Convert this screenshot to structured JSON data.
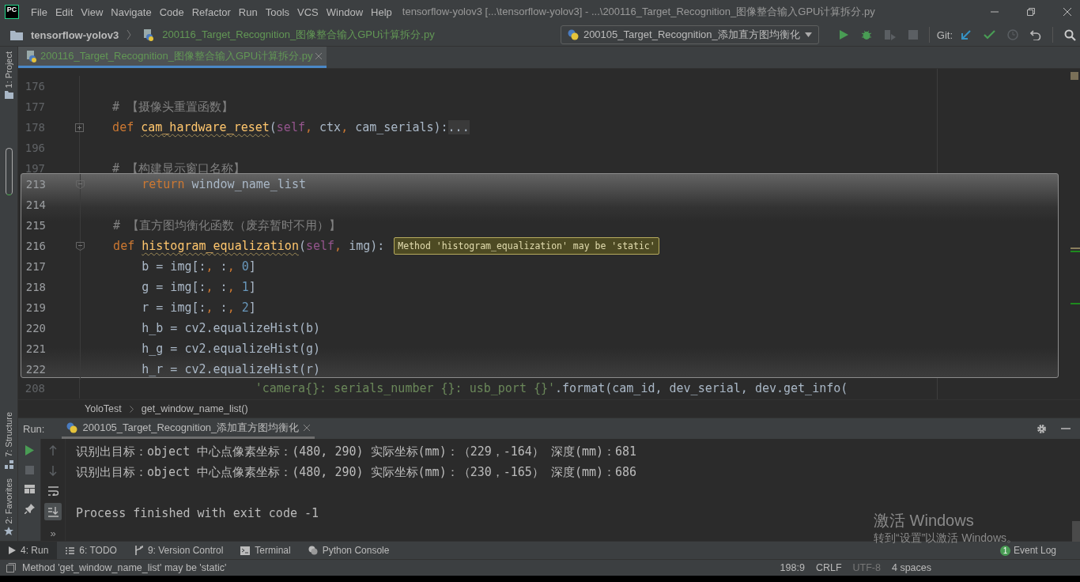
{
  "menu": {
    "logo": "PC",
    "items": [
      "File",
      "Edit",
      "View",
      "Navigate",
      "Code",
      "Refactor",
      "Run",
      "Tools",
      "VCS",
      "Window",
      "Help"
    ]
  },
  "window": {
    "title": "tensorflow-yolov3 [...\\tensorflow-yolov3] - ...\\200116_Target_Recognition_图像整合输入GPU计算拆分.py"
  },
  "navbar": {
    "project": "tensorflow-yolov3",
    "file": "200116_Target_Recognition_图像整合输入GPU计算拆分.py",
    "run_config": "200105_Target_Recognition_添加直方图均衡化",
    "git_label": "Git:"
  },
  "editor_tabs": [
    {
      "label": "200116_Target_Recognition_图像整合输入GPU计算拆分.py",
      "selected": true
    }
  ],
  "side_tools": [
    {
      "label": "1: Project",
      "kind": "project"
    },
    {
      "label": "7: Structure",
      "kind": "structure"
    },
    {
      "label": "2: Favorites",
      "kind": "favorites"
    }
  ],
  "code_lines": [
    {
      "number": "176"
    },
    {
      "number": "177",
      "tokens": [
        {
          "t": "    # 【摄像头重置函数】",
          "kind": "comment"
        }
      ]
    },
    {
      "number": "178",
      "collapsed": true,
      "tokens": [
        {
          "t": "    def ",
          "kind": "kw"
        },
        {
          "t": "cam_hardware_reset",
          "kind": "fn",
          "warning": true
        },
        {
          "t": "(",
          "kind": "plain"
        },
        {
          "t": "self",
          "kind": "self"
        },
        {
          "t": ", ",
          "kind": "kw"
        },
        {
          "t": "ctx",
          "kind": "plain"
        },
        {
          "t": ", ",
          "kind": "kw"
        },
        {
          "t": "cam_serials):",
          "kind": "plain"
        },
        {
          "t": "...",
          "kind": "folded"
        }
      ]
    },
    {
      "number": "196"
    },
    {
      "number": "197",
      "tokens": [
        {
          "t": "    # 【构建显示窗口名称】",
          "kind": "comment"
        }
      ]
    },
    {
      "number": "208",
      "tokens": [
        {
          "t": "                        'camera{}: serials_number {}: usb_port {}'",
          "kind": "str"
        },
        {
          "t": ".format(cam_id, dev_serial, dev.get_info(",
          "kind": "plain"
        }
      ]
    }
  ],
  "peek": {
    "lines": [
      {
        "number": "213",
        "collapsed": false,
        "tokens": [
          {
            "t": "        return ",
            "kind": "kw"
          },
          {
            "t": "window_name_list",
            "kind": "plain"
          }
        ]
      },
      {
        "number": "214"
      },
      {
        "number": "215",
        "tokens": [
          {
            "t": "    # 【直方图均衡化函数（废弃暂时不用）】",
            "kind": "comment"
          }
        ]
      },
      {
        "number": "216",
        "collapsed": false,
        "tokens": [
          {
            "t": "    def ",
            "kind": "kw"
          },
          {
            "t": "histogram_equalization",
            "kind": "fn",
            "warning": true
          },
          {
            "t": "(",
            "kind": "plain"
          },
          {
            "t": "self",
            "kind": "self"
          },
          {
            "t": ", ",
            "kind": "kw"
          },
          {
            "t": "img):",
            "kind": "plain"
          }
        ],
        "tooltip": "Method 'histogram_equalization' may be 'static'"
      },
      {
        "number": "217",
        "tokens": [
          {
            "t": "        b = img[:",
            "kind": "plain"
          },
          {
            "t": ", ",
            "kind": "kw"
          },
          {
            "t": ":",
            "kind": "plain"
          },
          {
            "t": ", ",
            "kind": "kw"
          },
          {
            "t": "0",
            "kind": "num"
          },
          {
            "t": "]",
            "kind": "plain"
          }
        ]
      },
      {
        "number": "218",
        "tokens": [
          {
            "t": "        g = img[:",
            "kind": "plain"
          },
          {
            "t": ", ",
            "kind": "kw"
          },
          {
            "t": ":",
            "kind": "plain"
          },
          {
            "t": ", ",
            "kind": "kw"
          },
          {
            "t": "1",
            "kind": "num"
          },
          {
            "t": "]",
            "kind": "plain"
          }
        ]
      },
      {
        "number": "219",
        "tokens": [
          {
            "t": "        r = img[:",
            "kind": "plain"
          },
          {
            "t": ", ",
            "kind": "kw"
          },
          {
            "t": ":",
            "kind": "plain"
          },
          {
            "t": ", ",
            "kind": "kw"
          },
          {
            "t": "2",
            "kind": "num"
          },
          {
            "t": "]",
            "kind": "plain"
          }
        ]
      },
      {
        "number": "220",
        "tokens": [
          {
            "t": "        h_b = cv2.equalizeHist(b)",
            "kind": "plain"
          }
        ]
      },
      {
        "number": "221",
        "tokens": [
          {
            "t": "        h_g = cv2.equalizeHist(g)",
            "kind": "plain"
          }
        ]
      },
      {
        "number": "222",
        "tokens": [
          {
            "t": "        h_r = cv2.equalizeHist(r)",
            "kind": "plain"
          }
        ]
      }
    ]
  },
  "breadcrumbs": [
    "YoloTest",
    "get_window_name_list()"
  ],
  "run": {
    "label": "Run:",
    "tab": "200105_Target_Recognition_添加直方图均衡化",
    "output": [
      {
        "text": "识别出目标：object 中心点像素坐标：(480, 290) 实际坐标(mm)：（229，-164） 深度(mm)：681",
        "kind": "log"
      },
      {
        "text": "识别出目标：object 中心点像素坐标：(480, 290) 实际坐标(mm)：（230，-165） 深度(mm)：686",
        "kind": "log"
      },
      {
        "text": "Process finished with exit code -1",
        "kind": "exit"
      }
    ],
    "more": "»"
  },
  "tool_tabs": [
    {
      "label": "4: Run",
      "kind": "run",
      "selected": true
    },
    {
      "label": "6: TODO",
      "kind": "todo",
      "selected": false
    },
    {
      "label": "9: Version Control",
      "kind": "vcs",
      "selected": false
    },
    {
      "label": "Terminal",
      "kind": "terminal",
      "selected": false
    },
    {
      "label": "Python Console",
      "kind": "python",
      "selected": false
    }
  ],
  "event_log": {
    "label": "Event Log",
    "count": "1"
  },
  "activation": {
    "title": "激活 Windows",
    "subtitle": "转到“设置”以激活 Windows。"
  },
  "status": {
    "message": "Method 'get_window_name_list' may be 'static'",
    "position": "198:9",
    "line_separator": "CRLF",
    "encoding": "UTF-8",
    "indent": "4 spaces"
  }
}
